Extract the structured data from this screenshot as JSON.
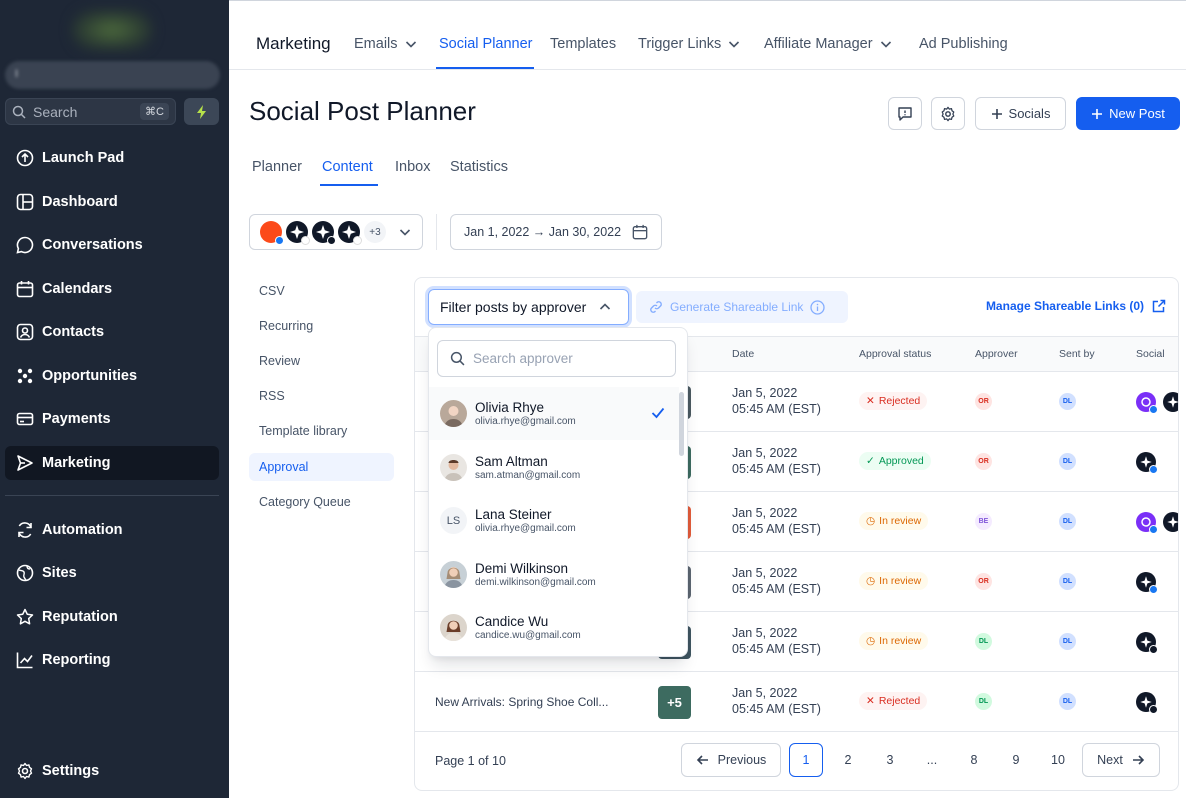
{
  "sidebar": {
    "account_name": "I",
    "search_placeholder": "Search",
    "search_shortcut": "⌘C",
    "items": [
      {
        "label": "Launch Pad",
        "icon": "launchpad-icon"
      },
      {
        "label": "Dashboard",
        "icon": "dashboard-icon"
      },
      {
        "label": "Conversations",
        "icon": "chat-icon"
      },
      {
        "label": "Calendars",
        "icon": "calendar-icon"
      },
      {
        "label": "Contacts",
        "icon": "contacts-icon"
      },
      {
        "label": "Opportunities",
        "icon": "opportunities-icon"
      },
      {
        "label": "Payments",
        "icon": "payments-icon"
      },
      {
        "label": "Marketing",
        "icon": "marketing-icon",
        "active": true
      },
      {
        "label": "Automation",
        "icon": "automation-icon"
      },
      {
        "label": "Sites",
        "icon": "globe-icon"
      },
      {
        "label": "Reputation",
        "icon": "star-icon"
      },
      {
        "label": "Reporting",
        "icon": "chart-icon"
      }
    ],
    "settings_label": "Settings"
  },
  "topnav": {
    "brand": "Marketing",
    "items": [
      "Emails",
      "Social Planner",
      "Templates",
      "Trigger Links",
      "Affiliate Manager",
      "Ad Publishing"
    ],
    "active": "Social Planner"
  },
  "page": {
    "title": "Social Post Planner",
    "socials_button": "Socials",
    "new_post_button": "New Post",
    "tabs": [
      "Planner",
      "Content",
      "Inbox",
      "Statistics"
    ],
    "active_tab": "Content",
    "accounts_more": "+3",
    "date_range": "Jan 1, 2022 → Jan 30, 2022"
  },
  "left_nav": [
    "CSV",
    "Recurring",
    "Review",
    "RSS",
    "Template library",
    "Approval",
    "Category Queue"
  ],
  "left_nav_active": "Approval",
  "panel": {
    "filter_label": "Filter posts by approver",
    "generate_link": "Generate Shareable Link",
    "manage_links": "Manage Shareable Links (0)",
    "columns": [
      "Date",
      "Approval status",
      "Approver",
      "Sent by",
      "Social"
    ],
    "rows": [
      {
        "title": "",
        "date": "Jan 5, 2022",
        "time": "05:45 AM (EST)",
        "status": "Rejected",
        "approver": "OR",
        "sent_by": "DL"
      },
      {
        "title": "",
        "date": "Jan 5, 2022",
        "time": "05:45 AM (EST)",
        "status": "Approved",
        "approver": "OR",
        "sent_by": "DL"
      },
      {
        "title": "",
        "date": "Jan 5, 2022",
        "time": "05:45 AM (EST)",
        "status": "In review",
        "approver": "BE",
        "sent_by": "DL"
      },
      {
        "title": "",
        "date": "Jan 5, 2022",
        "time": "05:45 AM (EST)",
        "status": "In review",
        "approver": "OR",
        "sent_by": "DL"
      },
      {
        "title": "",
        "date": "Jan 5, 2022",
        "time": "05:45 AM (EST)",
        "status": "In review",
        "approver": "DL",
        "sent_by": "DL"
      },
      {
        "title": "New Arrivals: Spring Shoe Coll...",
        "date": "Jan 5, 2022",
        "time": "05:45 AM (EST)",
        "status": "Rejected",
        "approver": "DL",
        "sent_by": "DL",
        "thumb_more": "+5"
      }
    ],
    "pagination": {
      "info": "Page 1 of 10",
      "previous": "Previous",
      "next": "Next",
      "pages": [
        "1",
        "2",
        "3",
        "...",
        "8",
        "9",
        "10"
      ],
      "current": "1"
    }
  },
  "dropdown": {
    "search_placeholder": "Search approver",
    "people": [
      {
        "name": "Olivia Rhye",
        "email": "olivia.rhye@gmail.com",
        "selected": true
      },
      {
        "name": "Sam Altman",
        "email": "sam.atman@gmail.com"
      },
      {
        "name": "Lana Steiner",
        "email": "olivia.rhye@gmail.com",
        "initials": "LS"
      },
      {
        "name": "Demi Wilkinson",
        "email": "demi.wilkinson@gmail.com"
      },
      {
        "name": "Candice Wu",
        "email": "candice.wu@gmail.com"
      }
    ]
  },
  "colors": {
    "sidebar_bg": "#1e2736",
    "accent": "#155eef"
  }
}
